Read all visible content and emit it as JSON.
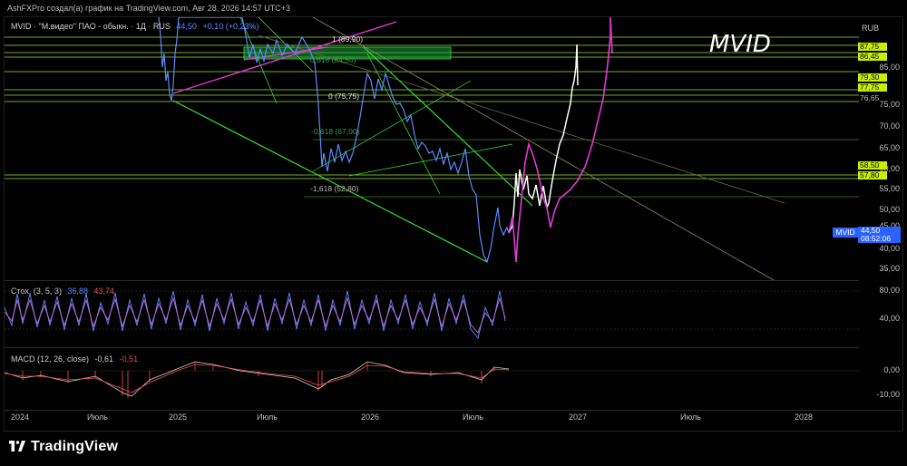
{
  "header": {
    "caption": "AshFXPro создал(а) график на TradingView.com, Авг 28, 2026 14:57 UTC+3"
  },
  "main_legend": {
    "symbol": "MVID · \"М.видео\" ПАО - обыкн. · 1Д · RUS",
    "last": "44,50",
    "change": "+0,10 (+0,23%)"
  },
  "overlay_title": "MVID",
  "price_axis": {
    "currency": "RUB",
    "labels": [
      "75,00",
      "70,00",
      "65,00",
      "60,00",
      "55,00",
      "50,00",
      "45,00",
      "40,00",
      "35,00"
    ],
    "highlighted": [
      "87,75",
      "86,45",
      "79,30",
      "77,75",
      "76,65",
      "58,50",
      "57,80"
    ],
    "partial": "85,00",
    "current_symbol": "MVID",
    "current_price": "44,50",
    "countdown": "08:52:06"
  },
  "fibonacci": {
    "level_1": "1 (89,90)",
    "level_0618_top": "0,618 (84,50)",
    "level_0": "0 (75,75)",
    "level_m0618": "-0,618 (67,00)",
    "level_m1618": "-1,618 (52,80)"
  },
  "stochastic": {
    "name": "Стох. (3, 5, 3)",
    "k": "36,88",
    "d": "43,74",
    "axis": [
      "80,00",
      "40,00"
    ]
  },
  "macd": {
    "name": "MACD (12, 26, close)",
    "v1": "-0,61",
    "v2": "-0,51",
    "axis": [
      "0,00",
      "-10,00"
    ]
  },
  "time_axis": [
    "2024",
    "Июль",
    "2025",
    "Июль",
    "2026",
    "Июль",
    "2027",
    "Июль",
    "2028"
  ],
  "brand": "TradingView",
  "colors": {
    "accent_green": "#c8f000",
    "price_line": "#5b8cff",
    "projection_magenta": "#e23ad6",
    "projection_white": "#ffffff",
    "trend_green": "#34e03b"
  }
}
